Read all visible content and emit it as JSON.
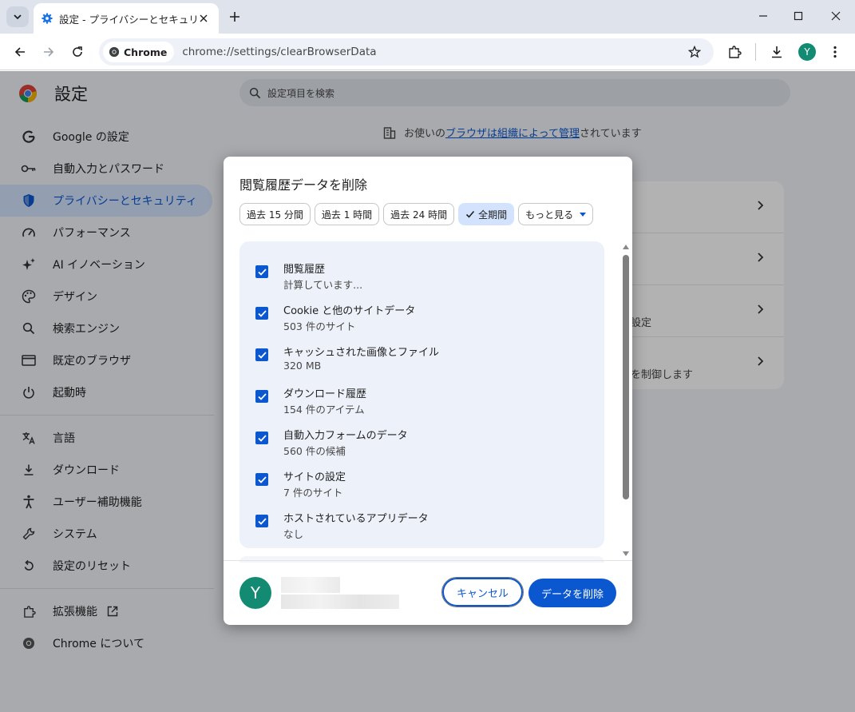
{
  "browser": {
    "tab_title": "設定 - プライバシーとセキュリティ",
    "chip_label": "Chrome",
    "url": "chrome://settings/clearBrowserData",
    "profile_initial": "Y"
  },
  "settings": {
    "title": "設定",
    "search_placeholder": "設定項目を検索",
    "managed_prefix": "お使いの",
    "managed_link": "ブラウザは組織によって管理",
    "managed_suffix": "されています",
    "sidebar": [
      {
        "label": "Google の設定",
        "icon": "google-icon"
      },
      {
        "label": "自動入力とパスワード",
        "icon": "key-icon"
      },
      {
        "label": "プライバシーとセキュリティ",
        "icon": "shield-icon",
        "active": true
      },
      {
        "label": "パフォーマンス",
        "icon": "speedometer-icon"
      },
      {
        "label": "AI イノベーション",
        "icon": "sparkle-icon"
      },
      {
        "label": "デザイン",
        "icon": "palette-icon"
      },
      {
        "label": "検索エンジン",
        "icon": "search-icon"
      },
      {
        "label": "既定のブラウザ",
        "icon": "browser-window-icon"
      },
      {
        "label": "起動時",
        "icon": "power-icon"
      },
      {
        "label": "言語",
        "icon": "translate-icon"
      },
      {
        "label": "ダウンロード",
        "icon": "download-icon"
      },
      {
        "label": "ユーザー補助機能",
        "icon": "accessibility-icon"
      },
      {
        "label": "システム",
        "icon": "wrench-icon"
      },
      {
        "label": "設定のリセット",
        "icon": "reset-icon"
      },
      {
        "label": "拡張機能",
        "icon": "puzzle-icon"
      },
      {
        "label": "Chrome について",
        "icon": "chrome-icon"
      }
    ],
    "card_partial": [
      "設定",
      "を制御します"
    ]
  },
  "dialog": {
    "title": "閲覧履歴データを削除",
    "time_ranges": [
      "過去 15 分間",
      "過去 1 時間",
      "過去 24 時間",
      "全期間"
    ],
    "selected_range": "全期間",
    "more_label": "もっと見る",
    "items": [
      {
        "title": "閲覧履歴",
        "subtitle": "計算しています...",
        "checked": true
      },
      {
        "title": "Cookie と他のサイトデータ",
        "subtitle": "503 件のサイト",
        "checked": true
      },
      {
        "title": "キャッシュされた画像とファイル",
        "subtitle": "320 MB",
        "checked": true
      },
      {
        "title": "ダウンロード履歴",
        "subtitle": "154 件のアイテム",
        "checked": true
      },
      {
        "title": "自動入力フォームのデータ",
        "subtitle": "560 件の候補",
        "checked": true
      },
      {
        "title": "サイトの設定",
        "subtitle": "7 件のサイト",
        "checked": true
      },
      {
        "title": "ホストされているアプリデータ",
        "subtitle": "なし",
        "checked": true
      }
    ],
    "account_initial": "Y",
    "cancel_label": "キャンセル",
    "delete_label": "データを削除"
  },
  "colors": {
    "accent": "#0b57d0",
    "avatar": "#138a72",
    "selected_chip_bg": "#d3e3fd",
    "list_bg": "#edf1f9"
  }
}
